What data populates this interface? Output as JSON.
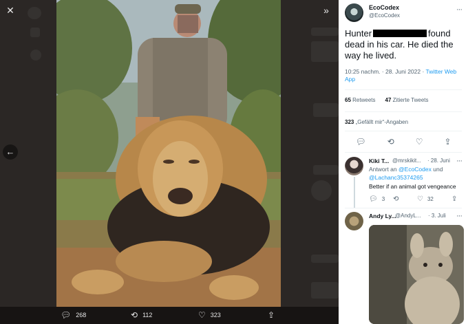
{
  "viewer": {
    "close_icon": "close-icon",
    "prev_icon": "arrow-left-icon",
    "expand_icon": "double-chevron-right-icon",
    "media_actions": [
      {
        "icon": "reply-icon",
        "count": "268"
      },
      {
        "icon": "retweet-icon",
        "count": "112"
      },
      {
        "icon": "heart-icon",
        "count": "323"
      },
      {
        "icon": "share-icon",
        "count": ""
      }
    ]
  },
  "tweet": {
    "author_name": "EcoCodex",
    "author_handle": "@EcoCodex",
    "text_before": "Hunter",
    "text_after": "found dead in his car. He died the way he lived.",
    "time": "10:25 nachm. · 28. Juni 2022 · ",
    "source": "Twitter Web App",
    "retweets_count": "65",
    "retweets_label": "Retweets",
    "quotes_count": "47",
    "quotes_label": "Zitierte Tweets",
    "likes_count": "323",
    "likes_label": "„Gefällt mir“-Angaben"
  },
  "replies": [
    {
      "name": "Kiki T...",
      "handle": "@mrskikit...",
      "date": "· 28. Juni",
      "reply_to_prefix": "Antwort an",
      "reply_to_1": "@EcoCodex",
      "reply_to_and": "und",
      "reply_to_2": "@Lachanc35374265",
      "text": "Better if an animal got vengeance",
      "reply_count": "3",
      "retweet_count": "",
      "like_count": "32"
    },
    {
      "name": "Andy Ly...",
      "handle": "@AndyL...",
      "date": "· 3. Juli"
    }
  ],
  "colors": {
    "accent": "#1d9bf0",
    "text": "#0f1419",
    "muted": "#536471",
    "viewer_bg": "#2b2725"
  }
}
